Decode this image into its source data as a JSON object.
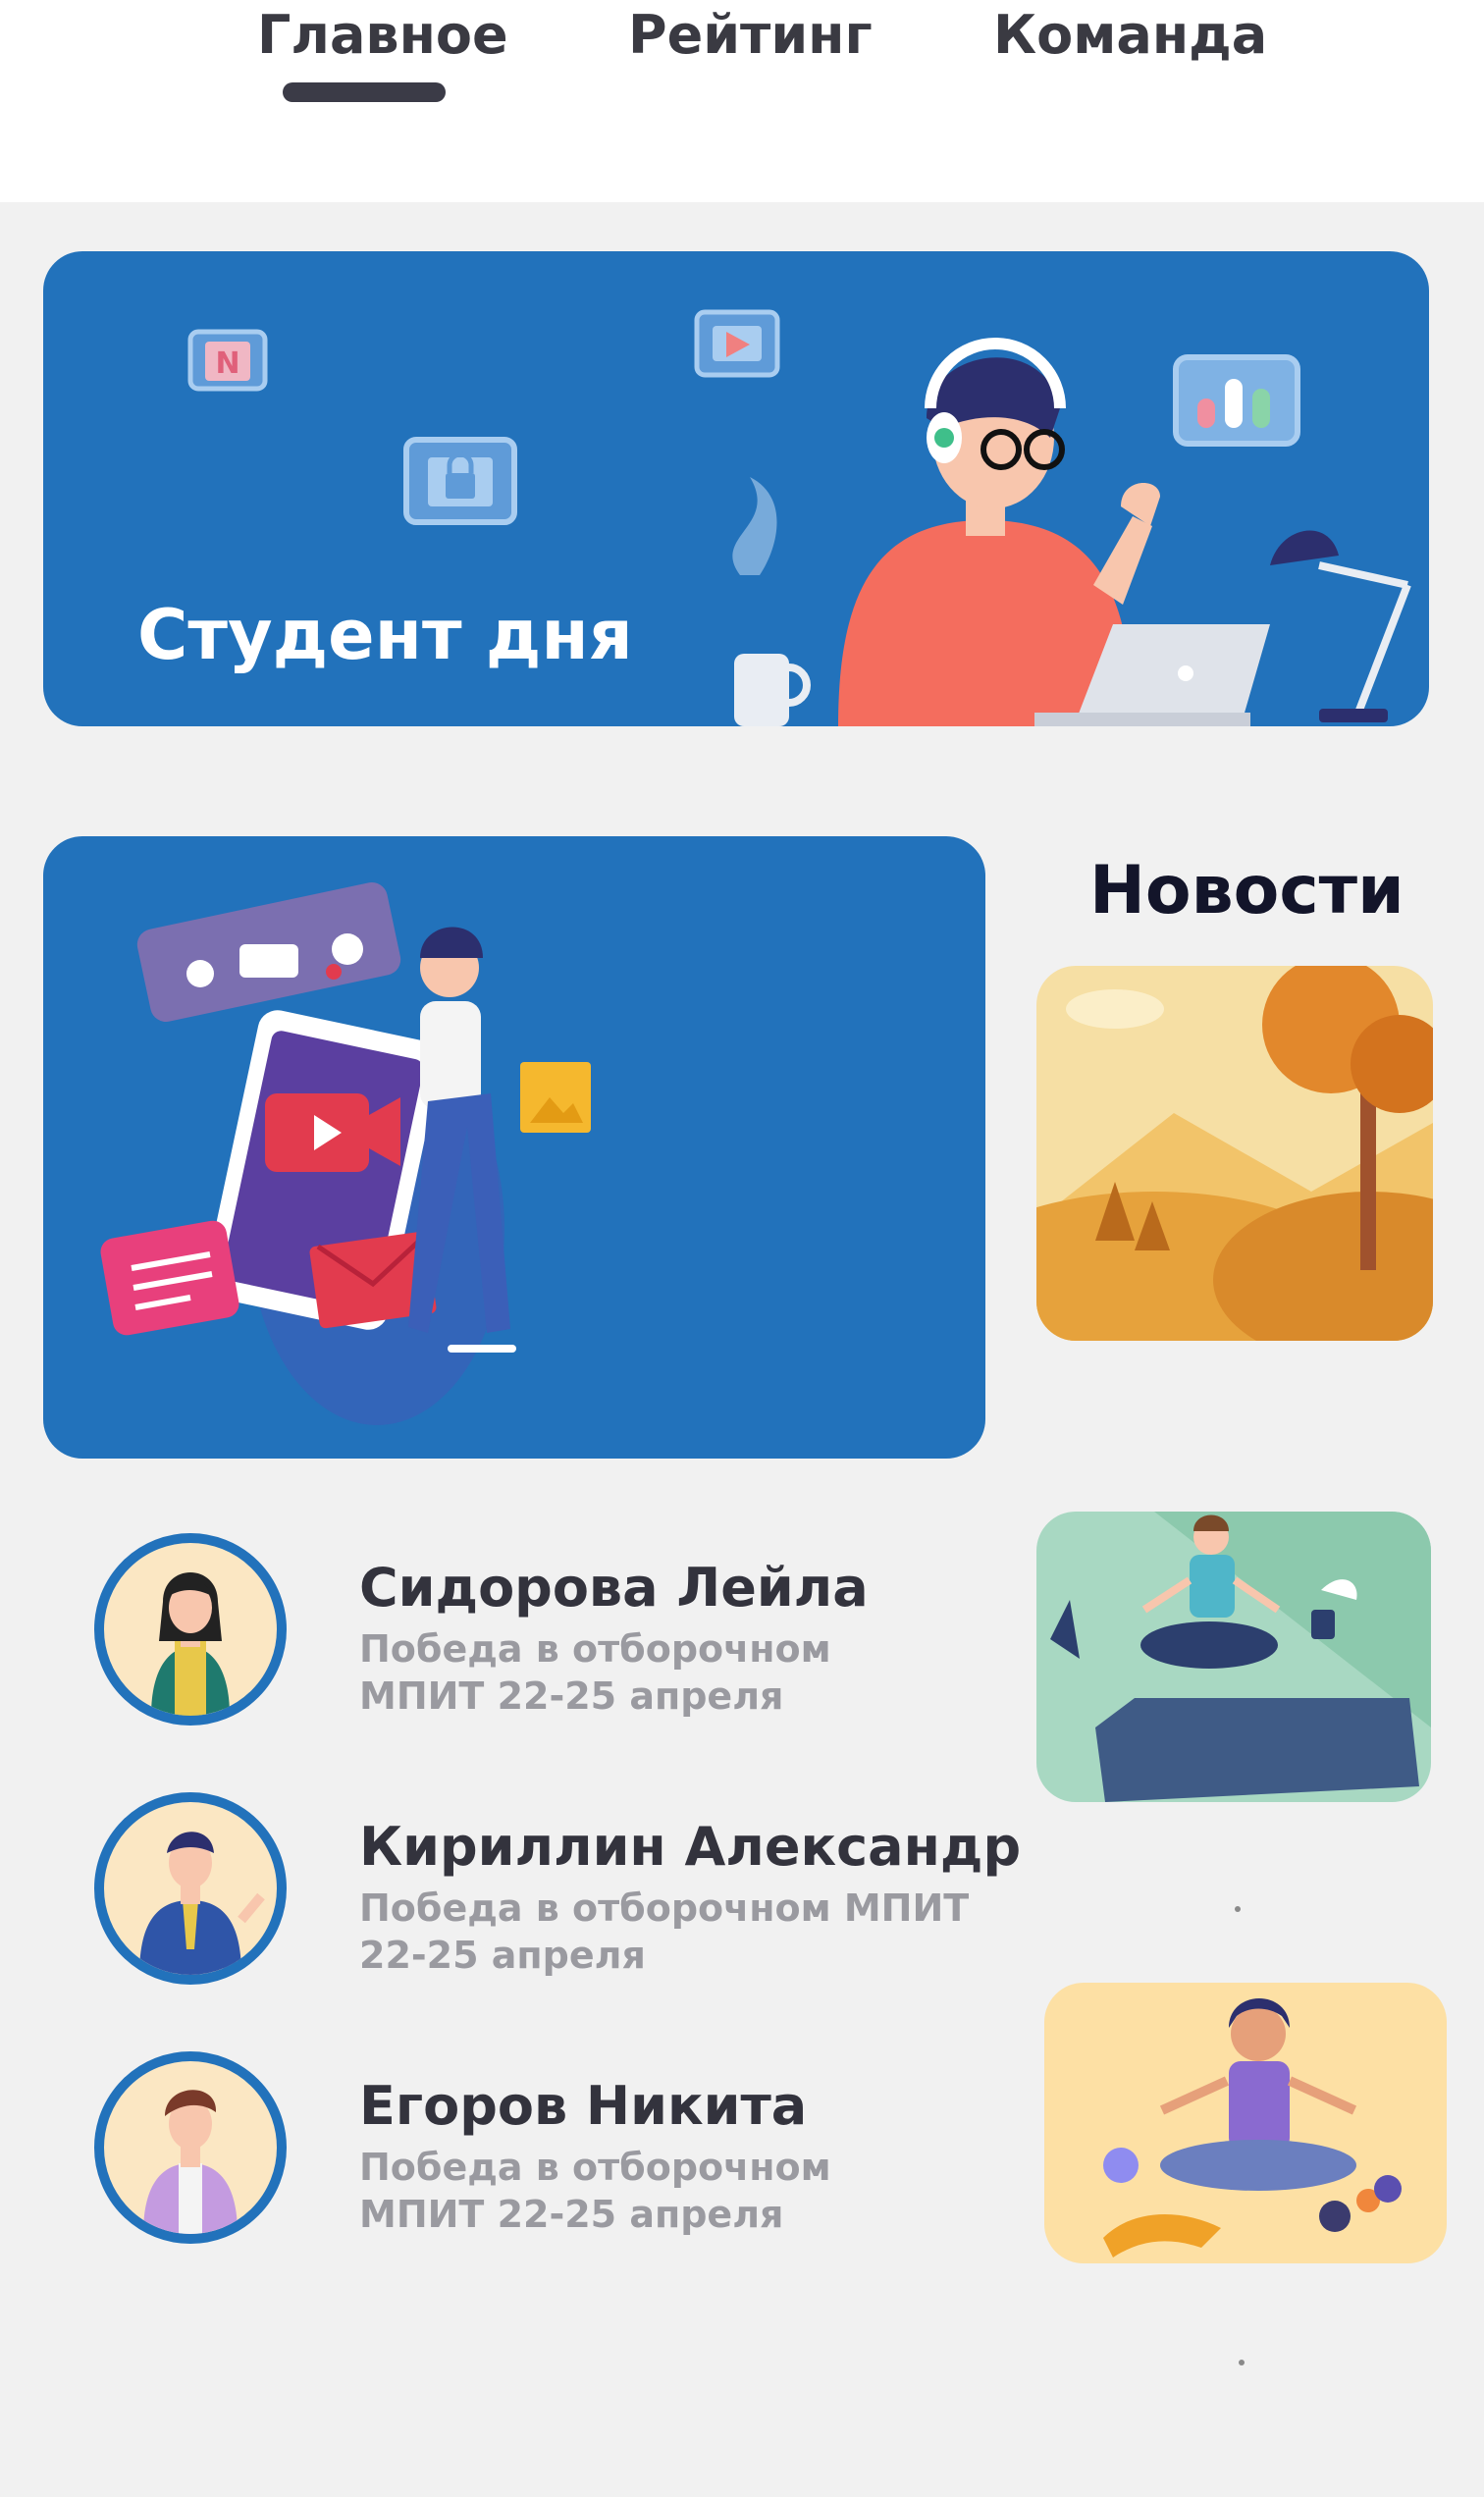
{
  "nav": {
    "tabs": [
      {
        "label": "Главное",
        "active": true
      },
      {
        "label": "Рейтинг",
        "active": false
      },
      {
        "label": "Команда",
        "active": false
      }
    ]
  },
  "banner": {
    "title": "Студент дня",
    "app_icons": [
      "notion-icon",
      "video-play-icon",
      "lock-icon",
      "stats-icon"
    ]
  },
  "news": {
    "title": "Новости"
  },
  "students": [
    {
      "name": "Сидорова Лейла",
      "desc_line1": "Победа в отборочном",
      "desc_line2": "МПИТ 22-25 апреля"
    },
    {
      "name": "Кириллин Александр",
      "desc_line1": "Победа в отборочном МПИТ",
      "desc_line2": "22-25 апреля"
    },
    {
      "name": "Егоров Никита",
      "desc_line1": "Победа в отборочном",
      "desc_line2": "МПИТ 22-25 апреля"
    }
  ],
  "colors": {
    "accent_blue": "#2272bb",
    "background": "#f1f1f1",
    "tab_text": "#3a3a42",
    "muted_text": "#9a9aa0"
  }
}
